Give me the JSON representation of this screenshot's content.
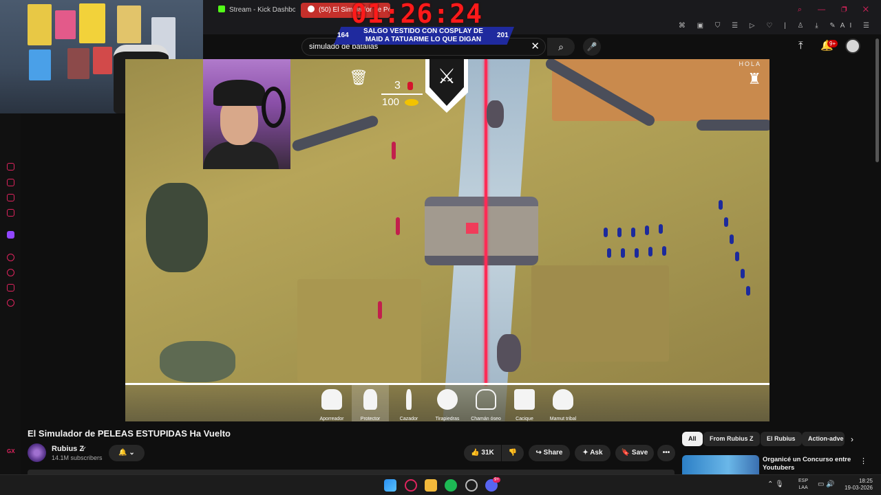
{
  "browser": {
    "tabs": [
      {
        "label": "Stream - Kick Dashboard"
      },
      {
        "label": "(50) El Simulador de Pe"
      }
    ],
    "window_controls": "⌕ — ❐ ✕"
  },
  "header": {
    "search_value": "simulado de batallas",
    "clear_icon": "✕",
    "search_icon": "⌕",
    "mic_icon": "🎤",
    "upload_icon": "⤒",
    "bell_icon": "🔔",
    "notifications": "9+"
  },
  "overlay": {
    "timer": "01:26:24",
    "goal_left": "164",
    "goal_text": "SALGO VESTIDO CON COSPLAY DE MAID A TATUARME LO QUE DIGAN",
    "goal_right": "201"
  },
  "game": {
    "trash_icon": "🗑",
    "unit_count": "3",
    "gold": "100",
    "battle_icon": "⚔",
    "hola": "HOLA",
    "castle_icon": "♜",
    "units": [
      {
        "label": "Aporreador"
      },
      {
        "label": "Protector"
      },
      {
        "label": "Cazador"
      },
      {
        "label": "Tirapiedras"
      },
      {
        "label": "Chamán óseo"
      },
      {
        "label": "Cacique"
      },
      {
        "label": "Mamut tribal"
      }
    ]
  },
  "video": {
    "title": "El Simulador de PELEAS ESTUPIDAS Ha Vuelto",
    "channel": "Rubius Z",
    "verified_icon": "✔",
    "subscribers": "14.1M subscribers",
    "bell_label": "🔔 ⌄",
    "like_count": "👍 31K",
    "dislike": "👎",
    "share": "↪ Share",
    "ask": "✦ Ask",
    "save": "🔖 Save",
    "more": "•••"
  },
  "recommendations": {
    "chips": [
      {
        "label": "All"
      },
      {
        "label": "From Rubius Z"
      },
      {
        "label": "El Rubius"
      },
      {
        "label": "Action-adve"
      }
    ],
    "next_icon": "›",
    "first_title": "Organicé un Concurso entre Youtubers",
    "menu_icon": "⋮"
  },
  "taskbar": {
    "lang_line1": "ESP",
    "lang_line2": "LAA",
    "time": "18:25",
    "date": "19-03-2026",
    "discord_badge": "9+",
    "tray_icons": "⌃ 🎙",
    "tray_right": "▭ 🔊"
  },
  "sidebar": {
    "gx_label": "GX"
  }
}
